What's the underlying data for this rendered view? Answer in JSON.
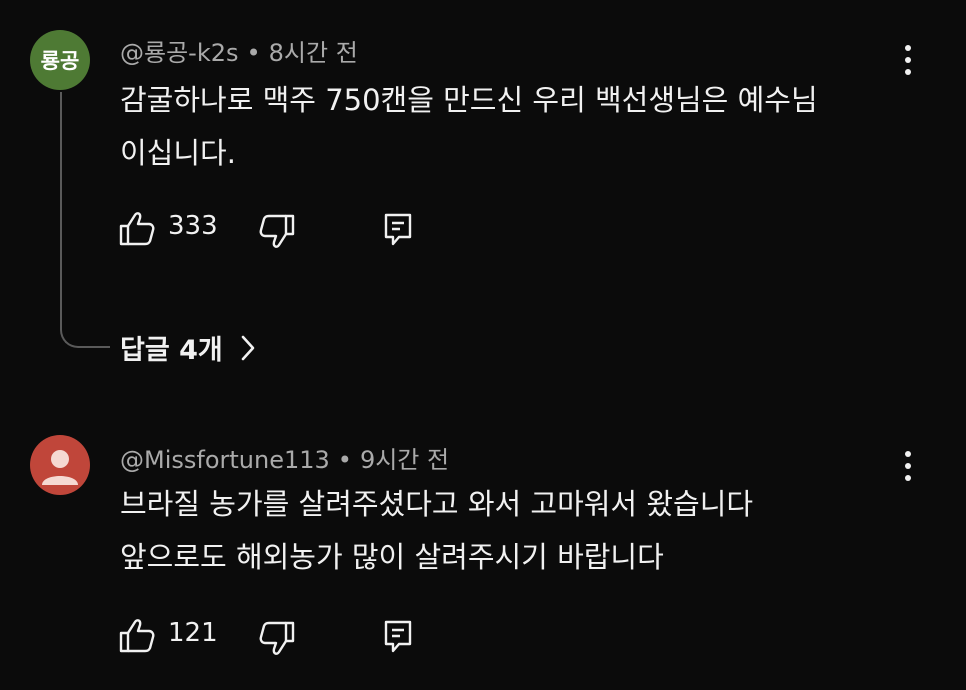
{
  "comments": [
    {
      "avatar_text": "룡공",
      "avatar_color": "#4e7a34",
      "author": "@룡공-k2s",
      "time": "8시간 전",
      "lines": [
        "감굴하나로 맥주 750캔을 만드신 우리 백선생님은 예수님",
        "이십니다."
      ],
      "likes": "333",
      "replies_label": "답글 4개"
    },
    {
      "avatar_color": "#c0463a",
      "author": "@Missfortune113",
      "time": "9시간 전",
      "lines": [
        "브라질 농가를 살려주셨다고 와서 고마워서 왔습니다",
        "앞으로도 해외농가 많이 살려주시기 바랍니다"
      ],
      "likes": "121"
    }
  ],
  "separator": "•",
  "icons": [
    "thumbs-up-icon",
    "thumbs-down-icon",
    "reply-icon",
    "more-options-icon",
    "chevron-right-icon"
  ]
}
